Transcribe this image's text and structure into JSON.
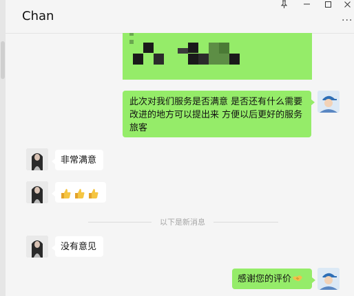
{
  "window": {
    "title": "Chan",
    "controls": {
      "pin": "🖈",
      "minimize": "—",
      "maximize": "☐",
      "close": "✕",
      "more": "···"
    }
  },
  "messages": [
    {
      "from": "self",
      "type": "image",
      "content": "",
      "note": ""
    },
    {
      "from": "self",
      "type": "text",
      "lines": [
        "此次对我们服务是否满意 是否还有什么需要",
        "改进的地方可以提出来 方便以后更好的服务",
        "旅客"
      ]
    },
    {
      "from": "contact",
      "type": "text",
      "text": "非常满意"
    },
    {
      "from": "contact",
      "type": "emoji",
      "emoji_names": [
        "thumbs-up",
        "thumbs-up",
        "thumbs-up"
      ]
    },
    {
      "from": "contact",
      "type": "text",
      "text": "没有意见"
    },
    {
      "from": "self",
      "type": "text",
      "text": "感谢您的评价",
      "emoji_name": "handshake"
    }
  ],
  "divider": {
    "text": "以下是新消息"
  },
  "colors": {
    "self_bubble": "#95ec69",
    "contact_bubble": "#ffffff",
    "background": "#f5f5f5"
  }
}
